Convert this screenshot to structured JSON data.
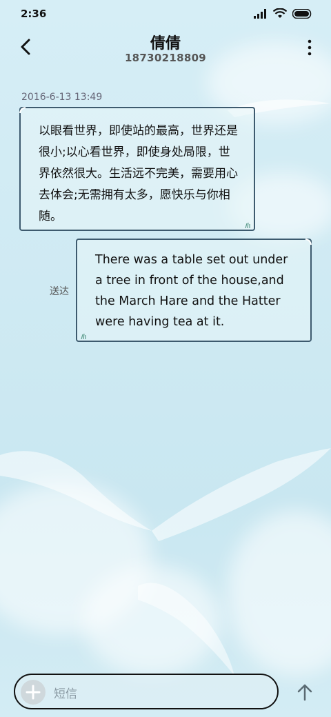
{
  "status_bar": {
    "time": "2:36"
  },
  "header": {
    "contact_name": "倩倩",
    "phone_number": "18730218809"
  },
  "conversation": {
    "timestamp": "2016-6-13 13:49",
    "messages": [
      {
        "direction": "incoming",
        "text": "以眼看世界，即使站的最高，世界还是很小;以心看世界，即使身处局限，世界依然很大。生活远不完美，需要用心去体会;无需拥有太多，愿快乐与你相随。"
      },
      {
        "direction": "outgoing",
        "text": "There was a table set out under a tree in front of the house,and the March Hare and the Hatter were having tea at it.",
        "status": "送达"
      }
    ]
  },
  "composer": {
    "placeholder": "短信"
  },
  "icons": {
    "back": "chevron-left-icon",
    "more": "more-vertical-icon",
    "add": "plus-icon",
    "send": "arrow-up-icon",
    "signal": "signal-icon",
    "wifi": "wifi-icon",
    "battery": "battery-icon"
  },
  "colors": {
    "bubble_border": "#3d5a6e",
    "background": "#cfeaf3"
  }
}
